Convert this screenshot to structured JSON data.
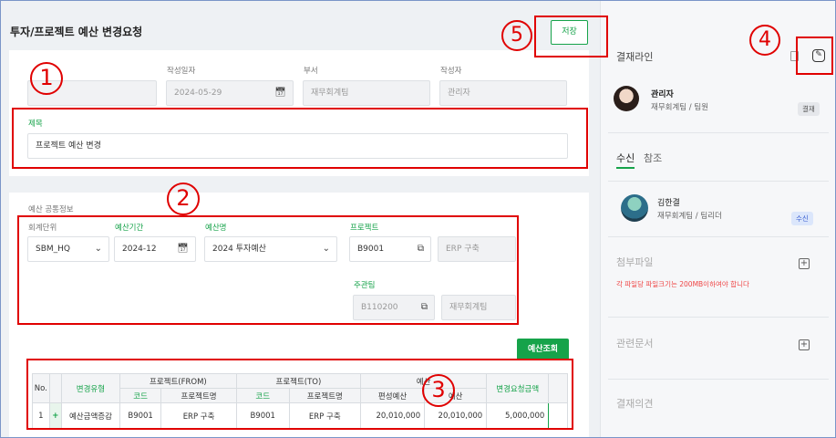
{
  "page": {
    "title": "투자/프로젝트 예산 변경요청",
    "save_label": "저장",
    "markers": [
      "1",
      "2",
      "3",
      "4",
      "5"
    ]
  },
  "basic": {
    "date_label": "작성일자",
    "date_value": "2024-05-29",
    "dept_label": "부서",
    "dept_value": "재무회계팀",
    "author_label": "작성자",
    "author_value": "관리자",
    "subject_label": "제목",
    "subject_value": "프로젝트 예산 변경"
  },
  "budget": {
    "section_label": "예산 공통정보",
    "unit_label": "회계단위",
    "unit_value": "SBM_HQ",
    "period_label": "예산기간",
    "period_value": "2024-12",
    "name_label": "예산명",
    "name_value": "2024 투자예산",
    "project_label": "프로젝트",
    "project_code": "B9001",
    "project_name": "ERP 구축",
    "owner_label": "주관팀",
    "owner_code": "B110200",
    "owner_name": "재무회계팀",
    "query_label": "예산조회"
  },
  "table": {
    "h_no": "No.",
    "h_type": "변경유형",
    "h_from": "프로젝트(FROM)",
    "h_to": "프로젝트(TO)",
    "h_budget": "예산",
    "h_request": "변경요청금액",
    "h_code": "코드",
    "h_pname": "프로젝트명",
    "h_plan": "편성예산",
    "h_remain": "예산",
    "rows": [
      {
        "no": "1",
        "type": "예산금액증감",
        "from_code": "B9001",
        "from_name": "ERP 구축",
        "to_code": "B9001",
        "to_name": "ERP 구축",
        "plan": "20,010,000",
        "remain": "20,010,000",
        "request": "5,000,000"
      }
    ]
  },
  "side": {
    "approval_title": "결재라인",
    "approver_name": "관리자",
    "approver_dept": "재무회계팀 / 팀원",
    "approver_badge": "결재",
    "tab_receive": "수신",
    "tab_ref": "참조",
    "receiver_name": "김한결",
    "receiver_dept": "재무회계팀 / 팀리더",
    "receiver_badge": "수신",
    "attach_title": "첨부파일",
    "attach_note": "각 파일당 파일크기는 200MB이하여야 합니다",
    "related_title": "관련문서",
    "opinion_title": "결재의견"
  },
  "colors": {
    "accent": "#16a34a",
    "annotation": "#e00000",
    "warning": "#ef4444"
  }
}
